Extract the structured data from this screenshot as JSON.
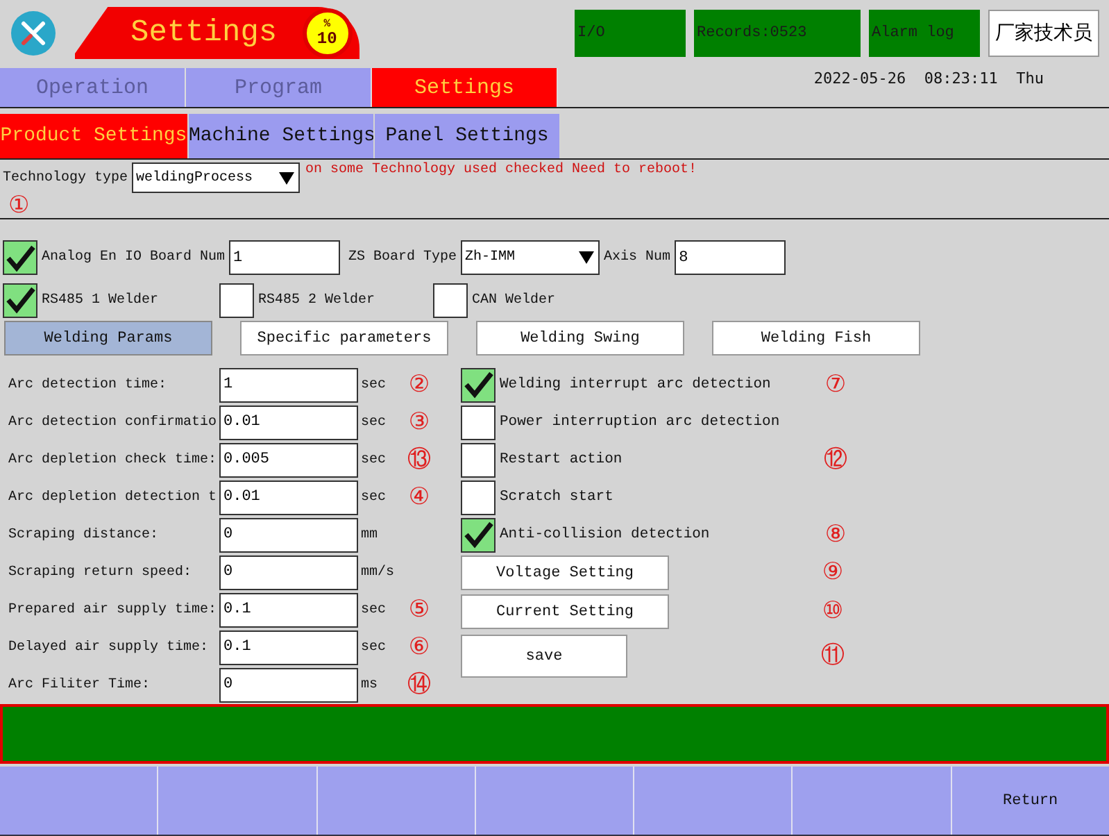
{
  "header": {
    "title": "Settings",
    "badge": {
      "symbol": "%",
      "value": "10"
    },
    "buttons": [
      {
        "label": "I/O",
        "kind": "status"
      },
      {
        "label": "Records:0523",
        "kind": "status"
      },
      {
        "label": "Alarm log",
        "kind": "status"
      },
      {
        "label": "厂家技术员",
        "kind": "user"
      }
    ]
  },
  "main_tabs": [
    {
      "label": "Operation",
      "selected": false
    },
    {
      "label": "Program",
      "selected": false
    },
    {
      "label": "Settings",
      "selected": true
    }
  ],
  "datetime": {
    "date": "2022-05-26",
    "time": "08:23:11",
    "weekday": "Thu"
  },
  "sub_tabs": [
    {
      "label": "Product Settings",
      "selected": true
    },
    {
      "label": "Machine Settings",
      "selected": false
    },
    {
      "label": "Panel Settings",
      "selected": false
    }
  ],
  "technology": {
    "label": "Technology type",
    "value": "weldingProcess",
    "warning": "on some Technology used checked Need to reboot!",
    "marker": "①"
  },
  "board": {
    "checkbox": {
      "label": "Analog En IO Board Num",
      "checked": true
    },
    "board_num": "1",
    "zs_label": "ZS Board Type",
    "zs_value": "Zh-IMM",
    "axis_label": "Axis Num",
    "axis_value": "8"
  },
  "welders": [
    {
      "label": "RS485 1 Welder",
      "checked": true
    },
    {
      "label": "RS485 2 Welder",
      "checked": false
    },
    {
      "label": "CAN Welder",
      "checked": false
    }
  ],
  "param_tabs": [
    {
      "label": "Welding Params",
      "selected": true
    },
    {
      "label": "Specific parameters",
      "selected": false
    },
    {
      "label": "Welding Swing",
      "selected": false
    },
    {
      "label": "Welding Fish",
      "selected": false
    }
  ],
  "params": [
    {
      "label": "Arc detection time:",
      "value": "1",
      "unit": "sec",
      "marker": "②"
    },
    {
      "label": "Arc detection confirmatio",
      "value": "0.01",
      "unit": "sec",
      "marker": "③"
    },
    {
      "label": "Arc depletion check time:",
      "value": "0.005",
      "unit": "sec",
      "marker": "⑬"
    },
    {
      "label": "Arc depletion detection t",
      "value": "0.01",
      "unit": "sec",
      "marker": "④"
    },
    {
      "label": "Scraping distance:",
      "value": "0",
      "unit": "mm"
    },
    {
      "label": "Scraping return speed:",
      "value": "0",
      "unit": "mm/s"
    },
    {
      "label": "Prepared air supply time:",
      "value": "0.1",
      "unit": "sec",
      "marker": "⑤"
    },
    {
      "label": "Delayed air supply time:",
      "value": "0.1",
      "unit": "sec",
      "marker": "⑥"
    },
    {
      "label": "Arc Filiter Time:",
      "value": "0",
      "unit": "ms",
      "marker": "⑭"
    }
  ],
  "options": [
    {
      "kind": "checkbox",
      "label": "Welding interrupt arc detection",
      "checked": true,
      "marker": "⑦"
    },
    {
      "kind": "checkbox",
      "label": "Power interruption arc detection",
      "checked": false
    },
    {
      "kind": "checkbox",
      "label": "Restart action",
      "checked": false,
      "marker": "⑫"
    },
    {
      "kind": "checkbox",
      "label": "Scratch start",
      "checked": false
    },
    {
      "kind": "checkbox",
      "label": "Anti-collision detection",
      "checked": true,
      "marker": "⑧"
    },
    {
      "kind": "button",
      "label": "Voltage Setting",
      "marker": "⑨"
    },
    {
      "kind": "button",
      "label": "Current Setting",
      "marker": "⑩"
    },
    {
      "kind": "action",
      "label": "save",
      "marker": "⑪"
    }
  ],
  "function_keys": [
    {
      "label": "Return"
    }
  ]
}
